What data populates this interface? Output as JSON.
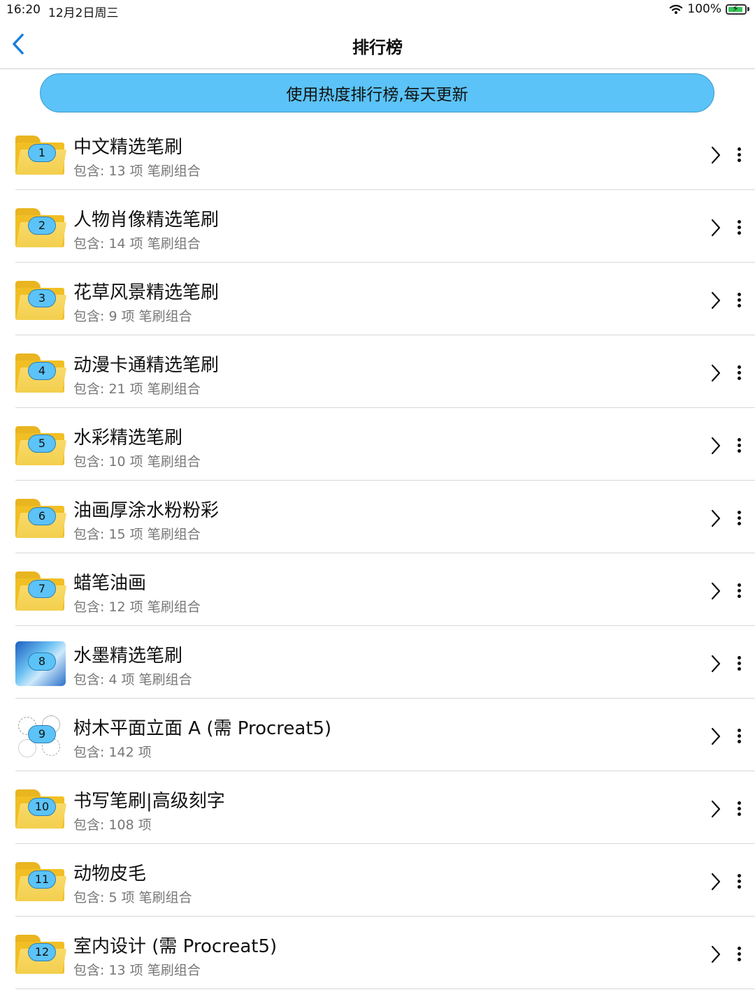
{
  "status_bar": {
    "time": "16:20",
    "date": "12月2日周三",
    "battery": "100%"
  },
  "nav": {
    "title": "排行榜"
  },
  "banner": {
    "text": "使用热度排行榜,每天更新"
  },
  "items": [
    {
      "rank": "1",
      "title": "中文精选笔刷",
      "subtitle": "包含: 13 项 笔刷组合",
      "thumb": "folder-icon"
    },
    {
      "rank": "2",
      "title": "人物肖像精选笔刷",
      "subtitle": "包含: 14 项 笔刷组合",
      "thumb": "folder-icon"
    },
    {
      "rank": "3",
      "title": "花草风景精选笔刷",
      "subtitle": "包含: 9 项 笔刷组合",
      "thumb": "folder-icon"
    },
    {
      "rank": "4",
      "title": "动漫卡通精选笔刷",
      "subtitle": "包含: 21 项 笔刷组合",
      "thumb": "folder-icon"
    },
    {
      "rank": "5",
      "title": "水彩精选笔刷",
      "subtitle": "包含: 10 项 笔刷组合",
      "thumb": "folder-icon"
    },
    {
      "rank": "6",
      "title": "油画厚涂水粉粉彩",
      "subtitle": "包含: 15 项 笔刷组合",
      "thumb": "folder-icon"
    },
    {
      "rank": "7",
      "title": "蜡笔油画",
      "subtitle": "包含: 12 项 笔刷组合",
      "thumb": "folder-icon"
    },
    {
      "rank": "8",
      "title": "水墨精选笔刷",
      "subtitle": "包含: 4 项 笔刷组合",
      "thumb": "image-thumbnail"
    },
    {
      "rank": "9",
      "title": "树木平面立面 A (需 Procreat5)",
      "subtitle": "包含: 142 项",
      "thumb": "tree-thumbnail"
    },
    {
      "rank": "10",
      "title": "书写笔刷|高级刻字",
      "subtitle": "包含: 108 项",
      "thumb": "folder-icon"
    },
    {
      "rank": "11",
      "title": "动物皮毛",
      "subtitle": "包含: 5 项 笔刷组合",
      "thumb": "folder-icon"
    },
    {
      "rank": "12",
      "title": "室内设计 (需 Procreat5)",
      "subtitle": "包含: 13 项 笔刷组合",
      "thumb": "folder-icon"
    }
  ],
  "colors": {
    "accent": "#5bc3f7",
    "folder": "#f1bf24",
    "back_arrow": "#1a7ee0"
  }
}
